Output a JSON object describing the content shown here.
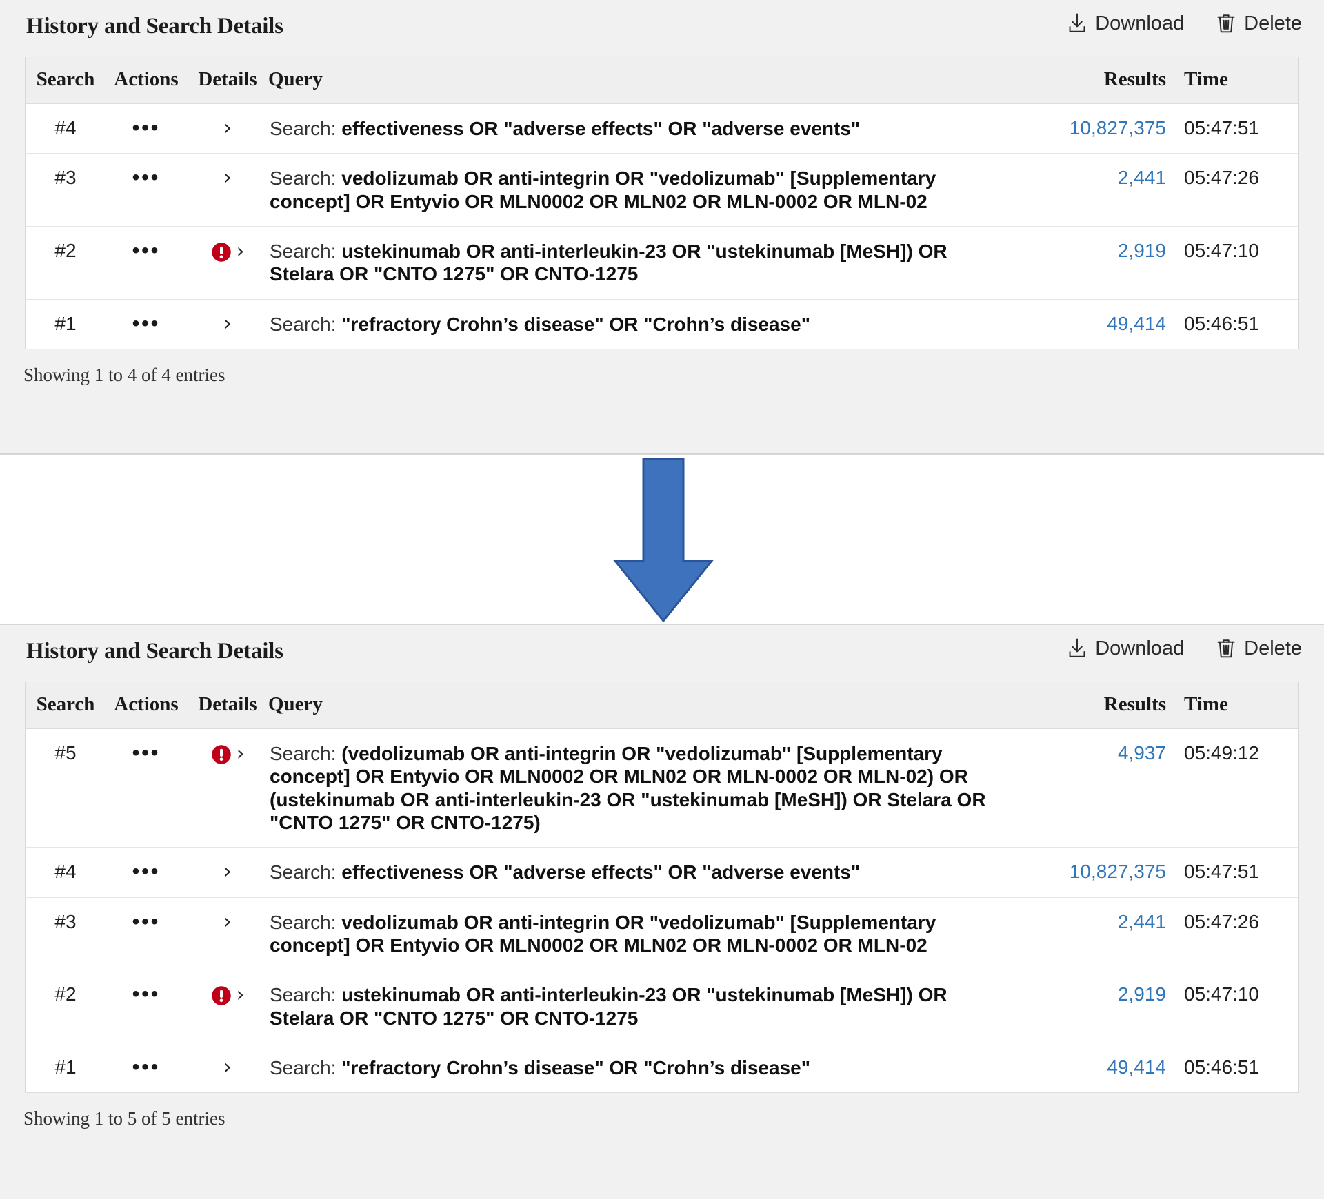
{
  "panels": [
    {
      "id": "before",
      "title": "History and Search Details",
      "actions": {
        "download_label": "Download",
        "download_icon": "download-icon",
        "delete_label": "Delete",
        "delete_icon": "trash-icon"
      },
      "columns": {
        "search": "Search",
        "actions": "Actions",
        "details": "Details",
        "query": "Query",
        "results": "Results",
        "time": "Time"
      },
      "rows": [
        {
          "search": "#4",
          "actions": "•••",
          "has_warning": false,
          "chevron": "›",
          "query_prefix": "Search: ",
          "query_text": "effectiveness OR \"adverse effects\" OR \"adverse events\"",
          "results": "10,827,375",
          "time": "05:47:51"
        },
        {
          "search": "#3",
          "actions": "•••",
          "has_warning": false,
          "chevron": "›",
          "query_prefix": "Search: ",
          "query_text": "vedolizumab OR anti-integrin OR \"vedolizumab\" [Supplementary concept] OR Entyvio OR MLN0002 OR MLN02 OR MLN-0002 OR MLN-02",
          "results": "2,441",
          "time": "05:47:26"
        },
        {
          "search": "#2",
          "actions": "•••",
          "has_warning": true,
          "chevron": "›",
          "query_prefix": "Search: ",
          "query_text": "ustekinumab OR anti-interleukin-23 OR \"ustekinumab [MeSH]) OR Stelara OR \"CNTO 1275\" OR CNTO-1275",
          "results": "2,919",
          "time": "05:47:10"
        },
        {
          "search": "#1",
          "actions": "•••",
          "has_warning": false,
          "chevron": "›",
          "query_prefix": "Search: ",
          "query_text": "\"refractory Crohn’s disease\" OR \"Crohn’s disease\"",
          "results": "49,414",
          "time": "05:46:51"
        }
      ],
      "showing": "Showing 1 to 4 of 4 entries"
    },
    {
      "id": "after",
      "title": "History and Search Details",
      "actions": {
        "download_label": "Download",
        "download_icon": "download-icon",
        "delete_label": "Delete",
        "delete_icon": "trash-icon"
      },
      "columns": {
        "search": "Search",
        "actions": "Actions",
        "details": "Details",
        "query": "Query",
        "results": "Results",
        "time": "Time"
      },
      "rows": [
        {
          "search": "#5",
          "actions": "•••",
          "has_warning": true,
          "chevron": "›",
          "query_prefix": "Search: ",
          "query_text": "(vedolizumab OR anti-integrin OR \"vedolizumab\" [Supplementary concept] OR Entyvio OR MLN0002 OR MLN02 OR MLN-0002 OR MLN-02) OR (ustekinumab OR anti-interleukin-23 OR \"ustekinumab [MeSH]) OR Stelara OR \"CNTO 1275\" OR CNTO-1275)",
          "results": "4,937",
          "time": "05:49:12"
        },
        {
          "search": "#4",
          "actions": "•••",
          "has_warning": false,
          "chevron": "›",
          "query_prefix": "Search: ",
          "query_text": "effectiveness OR \"adverse effects\" OR \"adverse events\"",
          "results": "10,827,375",
          "time": "05:47:51"
        },
        {
          "search": "#3",
          "actions": "•••",
          "has_warning": false,
          "chevron": "›",
          "query_prefix": "Search: ",
          "query_text": "vedolizumab OR anti-integrin OR \"vedolizumab\" [Supplementary concept] OR Entyvio OR MLN0002 OR MLN02 OR MLN-0002 OR MLN-02",
          "results": "2,441",
          "time": "05:47:26"
        },
        {
          "search": "#2",
          "actions": "•••",
          "has_warning": true,
          "chevron": "›",
          "query_prefix": "Search: ",
          "query_text": "ustekinumab OR anti-interleukin-23 OR \"ustekinumab [MeSH]) OR Stelara OR \"CNTO 1275\" OR CNTO-1275",
          "results": "2,919",
          "time": "05:47:10"
        },
        {
          "search": "#1",
          "actions": "•••",
          "has_warning": false,
          "chevron": "›",
          "query_prefix": "Search: ",
          "query_text": "\"refractory Crohn’s disease\" OR \"Crohn’s disease\"",
          "results": "49,414",
          "time": "05:46:51"
        }
      ],
      "showing": "Showing 1 to 5 of 5 entries"
    }
  ],
  "arrow": {
    "icon": "down-arrow-icon",
    "fill": "#3f72bd",
    "stroke": "#2a5699"
  },
  "colors": {
    "panel_background": "#f1f1f1",
    "table_background": "#ffffff",
    "header_background": "#efefef",
    "link": "#3076b8",
    "warning": "#c00018",
    "text": "#1f1f1f"
  }
}
